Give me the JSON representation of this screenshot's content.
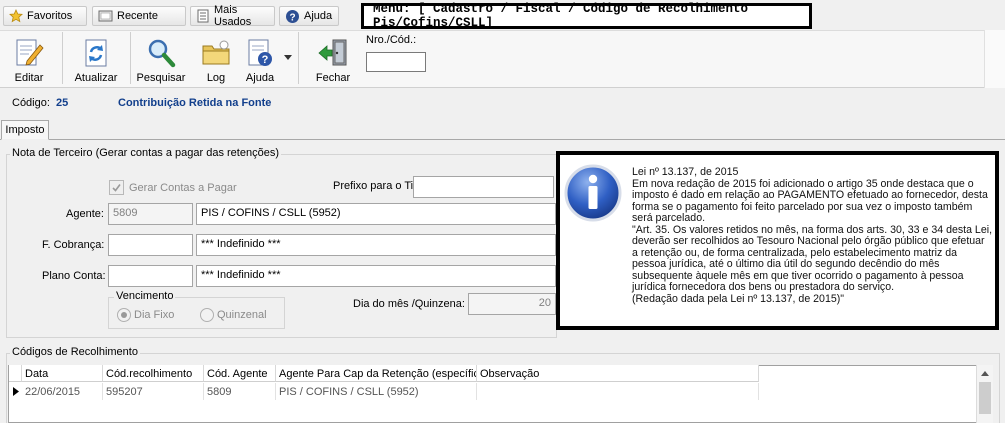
{
  "nav": {
    "favorites": "Favoritos",
    "recent": "Recente",
    "most_used": "Mais Usados",
    "help": "Ajuda",
    "menu_path": "Menu: [ Cadastro / Fiscal / Código de Recolhimento Pis/Cofins/CSLL]"
  },
  "toolbar": {
    "edit": "Editar",
    "refresh": "Atualizar",
    "search": "Pesquisar",
    "log": "Log",
    "help": "Ajuda",
    "close": "Fechar",
    "nro_label": "Nro./Cód.:",
    "nro_value": ""
  },
  "record": {
    "code_label": "Código:",
    "code_value": "25",
    "description": "Contribuição Retida na Fonte"
  },
  "tabs": [
    {
      "label": "Imposto"
    }
  ],
  "third_party": {
    "legend": "Nota de Terceiro (Gerar contas a pagar das retenções)",
    "generate_checkbox": "Gerar Contas a Pagar",
    "title_prefix_label": "Prefixo para o Titulo:",
    "title_prefix_value": "",
    "agent_label": "Agente:",
    "agent_code": "5809",
    "agent_name": "PIS / COFINS / CSLL (5952)",
    "collection_label": "F. Cobrança:",
    "collection_code": "",
    "collection_name": "*** Indefinido ***",
    "account_label": "Plano Conta:",
    "account_code": "",
    "account_name": "*** Indefinido ***",
    "due_legend": "Vencimento",
    "due_fixed": "Dia Fixo",
    "due_biweekly": "Quinzenal",
    "day_label": "Dia do mês /Quinzena:",
    "day_value": "20"
  },
  "info": {
    "text": "Lei nº 13.137, de 2015\nEm nova redação de 2015 foi adicionado o artigo 35 onde destaca que o imposto é dado em relação ao PAGAMENTO efetuado ao fornecedor, desta forma se o pagamento foi feito parcelado por sua vez o imposto também será parcelado.\n\"Art. 35.  Os valores retidos no mês, na forma dos arts. 30, 33 e 34 desta Lei, deverão ser recolhidos ao Tesouro Nacional pelo órgão público que efetuar a retenção ou, de forma centralizada, pelo estabelecimento matriz da pessoa jurídica, até o último dia útil do segundo decêndio do mês subsequente àquele mês em que tiver ocorrido o pagamento à pessoa jurídica fornecedora dos bens ou prestadora do serviço.\n(Redação dada pela Lei nº 13.137, de 2015)\""
  },
  "codes": {
    "legend": "Códigos de Recolhimento",
    "columns": [
      "Data",
      "Cód.recolhimento",
      "Cód. Agente",
      "Agente Para Cap da Retenção (específico",
      "Observação"
    ],
    "rows": [
      [
        "22/06/2015",
        "595207",
        "5809",
        "PIS / COFINS / CSLL (5952)",
        ""
      ]
    ]
  }
}
